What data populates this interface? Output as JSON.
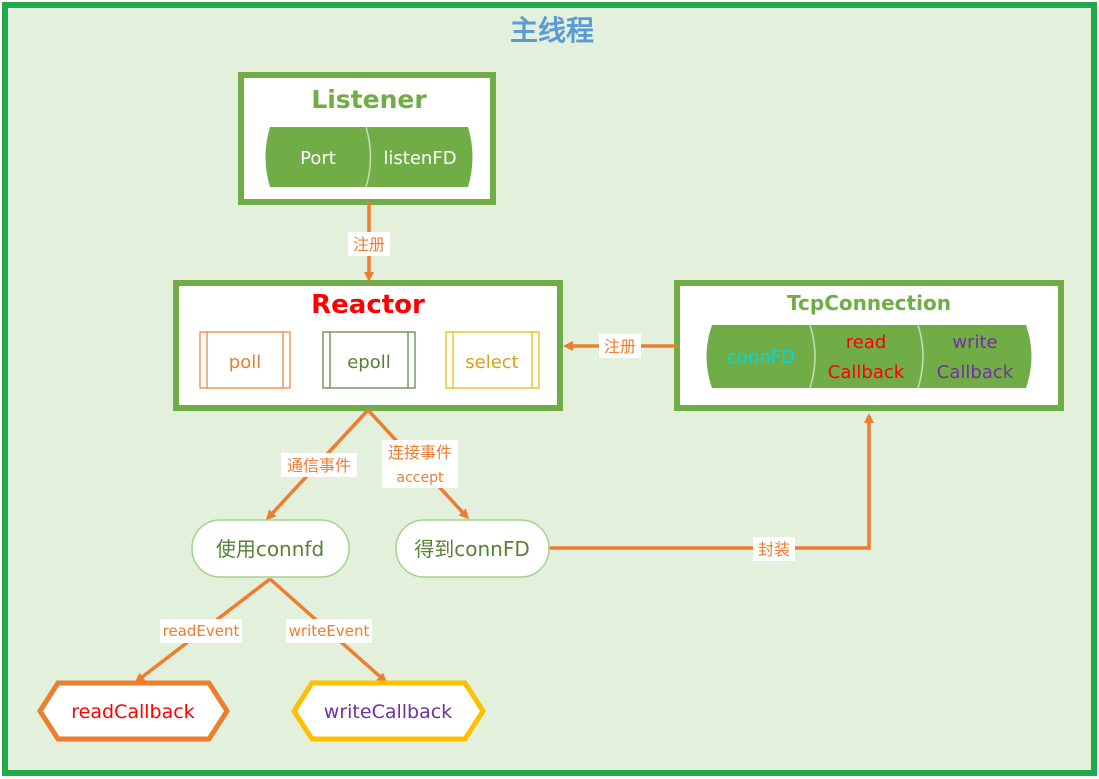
{
  "title": "主线程",
  "listener": {
    "title": "Listener",
    "fields": [
      "Port",
      "listenFD"
    ]
  },
  "reactor": {
    "title": "Reactor",
    "items": [
      "poll",
      "epoll",
      "select"
    ]
  },
  "tcp_connection": {
    "title": "TcpConnection",
    "fields": [
      {
        "lines": [
          "connFD"
        ]
      },
      {
        "lines": [
          "read",
          "Callback"
        ]
      },
      {
        "lines": [
          "write",
          "Callback"
        ]
      }
    ]
  },
  "nodes": {
    "use_connfd": "使用connfd",
    "get_connfd": "得到connFD",
    "read_callback": "readCallback",
    "write_callback": "writeCallback"
  },
  "edges": {
    "register_listener": "注册",
    "register_tcp": "注册",
    "comm_event": "通信事件",
    "conn_event": "连接事件",
    "conn_event_sub": "accept",
    "wrap": "封装",
    "read_event": "readEvent",
    "write_event": "writeEvent"
  },
  "colors": {
    "frame": "#22a94b",
    "background": "#e3f0db",
    "box_border": "#70ad47",
    "box_title": "#70ad47",
    "title_blue": "#5b9bd5",
    "reactor_red": "#ff0000",
    "arrow": "#ed7d31",
    "field_fill": "#70ad47",
    "conn_cyan": "#00d9e6",
    "write_purple": "#7030a0",
    "select_gold": "#e6b800",
    "node_text": "#548235"
  }
}
